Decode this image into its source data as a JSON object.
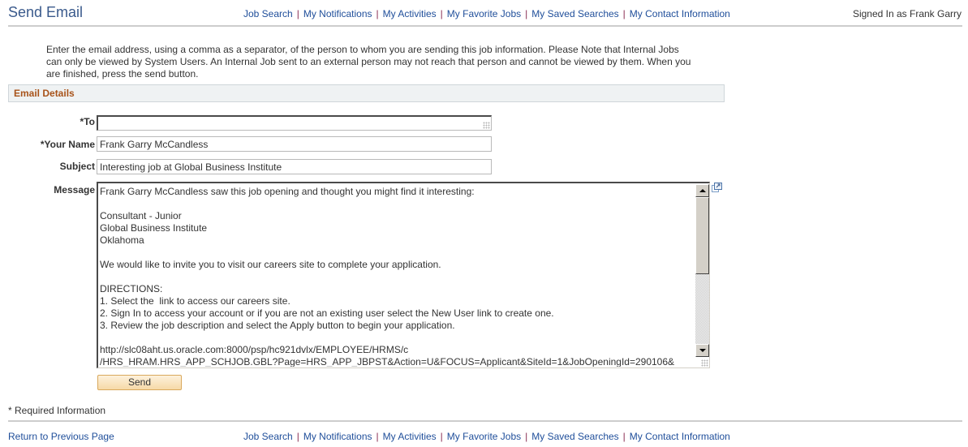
{
  "header": {
    "page_title": "Send Email",
    "signed_in": "Signed In as Frank Garry"
  },
  "nav": {
    "links": [
      {
        "label": "Job Search"
      },
      {
        "label": "My Notifications"
      },
      {
        "label": "My Activities"
      },
      {
        "label": "My Favorite Jobs"
      },
      {
        "label": "My Saved Searches"
      },
      {
        "label": "My Contact Information"
      }
    ],
    "separator": "|"
  },
  "instructions": "Enter the email address, using a comma as a separator, of the person to whom you are sending this job information. Please Note that Internal Jobs can only be viewed by System Users. An Internal Job sent to an external person may not reach that person and cannot be viewed by them. When you are finished, press the send button.",
  "section": {
    "title": "Email Details"
  },
  "form": {
    "to": {
      "label": "*To",
      "value": ""
    },
    "your_name": {
      "label": "*Your Name",
      "value": "Frank Garry McCandless"
    },
    "subject": {
      "label": "Subject",
      "value": "Interesting job at Global Business Institute"
    },
    "message": {
      "label": "Message",
      "value": "Frank Garry McCandless saw this job opening and thought you might find it interesting:\n\nConsultant - Junior\nGlobal Business Institute\nOklahoma\n\nWe would like to invite you to visit our careers site to complete your application.\n\nDIRECTIONS:\n1. Select the  link to access our careers site.\n2. Sign In to access your account or if you are not an existing user select the New User link to create one.\n3. Review the job description and select the Apply button to begin your application.\n\nhttp://slc08aht.us.oracle.com:8000/psp/hc921dvlx/EMPLOYEE/HRMS/c\n/HRS_HRAM.HRS_APP_SCHJOB.GBL?Page=HRS_APP_JBPST&Action=U&FOCUS=Applicant&SiteId=1&JobOpeningId=290106&"
    },
    "send_label": "Send",
    "expand_icon": "expand-window-icon"
  },
  "footer": {
    "required_note": "* Required Information",
    "return_link": "Return to Previous Page"
  },
  "colors": {
    "title": "#3a5a8c",
    "link": "#1f4e9a",
    "separator": "#8a2d52",
    "section_title": "#a8531a",
    "section_bg": "#eff2f3",
    "button_bg": "#f6d9a7"
  }
}
